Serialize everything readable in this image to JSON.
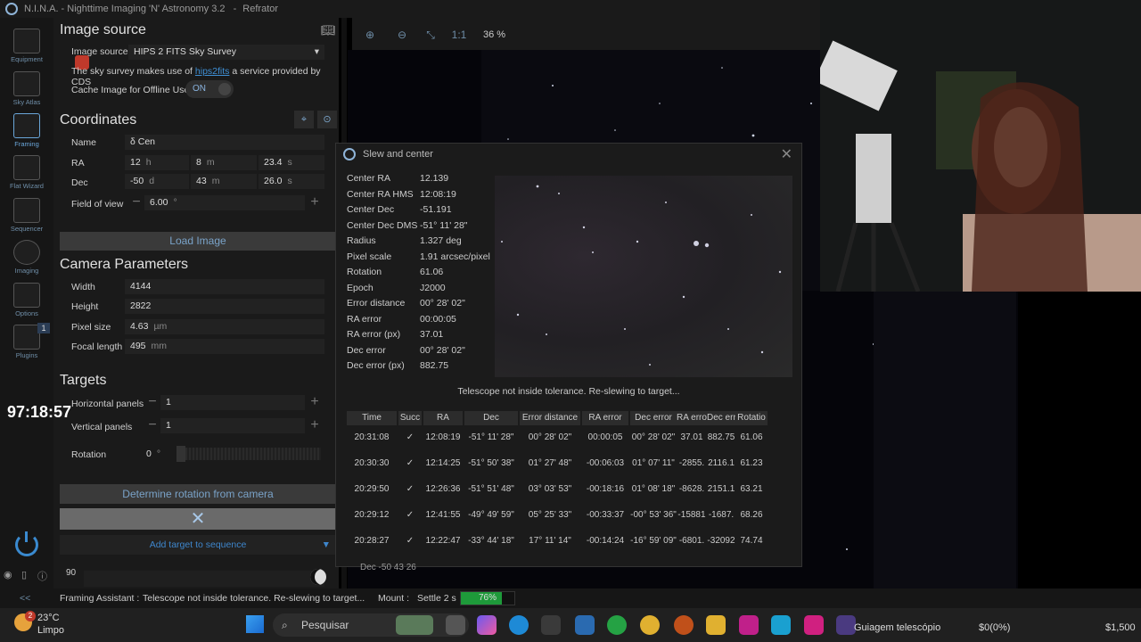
{
  "titlebar": {
    "app": "N.I.N.A. - Nighttime Imaging 'N' Astronomy 3.2",
    "profile": "Refrator"
  },
  "nav": [
    {
      "label": "Equipment"
    },
    {
      "label": "Sky Atlas"
    },
    {
      "label": "Framing"
    },
    {
      "label": "Flat Wizard"
    },
    {
      "label": "Sequencer"
    },
    {
      "label": "Imaging"
    },
    {
      "label": "Options"
    },
    {
      "label": "Plugins"
    }
  ],
  "plugin_badge": "1",
  "image_source": {
    "title": "Image source",
    "label": "Image source",
    "value": "HIPS 2 FITS Sky Survey",
    "note_prefix": "The sky survey makes use of",
    "link": "hips2fits",
    "note_suffix": "a service provided by CDS",
    "cache_label": "Cache Image for Offline Use",
    "cache_state": "ON"
  },
  "coordinates": {
    "title": "Coordinates",
    "name_label": "Name",
    "name": "δ Cen",
    "ra_label": "RA",
    "ra": [
      "12",
      "8",
      "23.4"
    ],
    "ra_units": [
      "h",
      "m",
      "s"
    ],
    "dec_label": "Dec",
    "dec": [
      "-50",
      "43",
      "26.0"
    ],
    "dec_units": [
      "d",
      "m",
      "s"
    ],
    "fov_label": "Field of view",
    "fov": "6.00",
    "fov_unit": "°",
    "load_button": "Load Image"
  },
  "camera": {
    "title": "Camera Parameters",
    "width_label": "Width",
    "width": "4144",
    "height_label": "Height",
    "height": "2822",
    "pixel_label": "Pixel size",
    "pixel": "4.63",
    "pixel_unit": "µm",
    "focal_label": "Focal length",
    "focal": "495",
    "focal_unit": "mm"
  },
  "targets": {
    "title": "Targets",
    "hpanels_label": "Horizontal panels",
    "hpanels": "1",
    "vpanels_label": "Vertical panels",
    "vpanels": "1",
    "rotation_label": "Rotation",
    "rotation": "0",
    "rotation_unit": "°",
    "determine_button": "Determine rotation from camera",
    "add_button": "Add target to sequence",
    "slider_value": "90"
  },
  "timer": "97:18:57",
  "zoom": "36 %",
  "zoom_1to1": "1:1",
  "dialog": {
    "title": "Slew and center",
    "fields": [
      {
        "k": "Center RA",
        "v": "12.139"
      },
      {
        "k": "Center RA HMS",
        "v": "12:08:19"
      },
      {
        "k": "Center Dec",
        "v": "-51.191"
      },
      {
        "k": "Center Dec DMS",
        "v": "-51° 11' 28\""
      },
      {
        "k": "Radius",
        "v": "1.327 deg"
      },
      {
        "k": "Pixel scale",
        "v": "1.91 arcsec/pixel"
      },
      {
        "k": "Rotation",
        "v": "61.06"
      },
      {
        "k": "Epoch",
        "v": "J2000"
      },
      {
        "k": "Error distance",
        "v": "00° 28' 02\""
      },
      {
        "k": "RA error",
        "v": "00:00:05"
      },
      {
        "k": "RA error (px)",
        "v": "37.01"
      },
      {
        "k": "Dec error",
        "v": "00° 28' 02\""
      },
      {
        "k": "Dec error (px)",
        "v": "882.75"
      }
    ],
    "status": "Telescope not inside tolerance. Re-slewing to target...",
    "columns": [
      "Time",
      "Succ",
      "RA",
      "Dec",
      "Error distance",
      "RA error",
      "Dec error",
      "RA erro",
      "Dec err",
      "Rotatio"
    ],
    "rows": [
      [
        "20:31:08",
        "✓",
        "12:08:19",
        "-51° 11' 28\"",
        "00° 28' 02\"",
        "00:00:05",
        "00° 28' 02\"",
        "37.01",
        "882.75",
        "61.06"
      ],
      [
        "20:30:30",
        "✓",
        "12:14:25",
        "-51° 50' 38\"",
        "01° 27' 48\"",
        "-00:06:03",
        "01° 07' 11\"",
        "-2855.",
        "2116.1",
        "61.23"
      ],
      [
        "20:29:50",
        "✓",
        "12:26:36",
        "-51° 51' 48\"",
        "03° 03' 53\"",
        "-00:18:16",
        "01° 08' 18\"",
        "-8628.",
        "2151.1",
        "63.21"
      ],
      [
        "20:29:12",
        "✓",
        "12:41:55",
        "-49° 49' 59\"",
        "05° 25' 33\"",
        "-00:33:37",
        "-00° 53' 36\"",
        "-15881",
        "-1687.",
        "68.26"
      ],
      [
        "20:28:27",
        "✓",
        "12:22:47",
        "-33° 44' 18\"",
        "17° 11' 14\"",
        "-00:14:24",
        "-16° 59' 09\"",
        "-6801.",
        "-32092",
        "74.74"
      ]
    ],
    "behind_text": "Dec -50 43 26"
  },
  "statusbar": {
    "module": "Framing Assistant :",
    "message": "Telescope not inside tolerance. Re-slewing to target...",
    "mount": "Mount :",
    "mount_msg": "Settle 2 s",
    "progress_pct": 76,
    "progress_label": "76%"
  },
  "taskbar": {
    "temp": "23°C",
    "weather": "Limpo",
    "weather_badge": "2",
    "search": "Pesquisar",
    "app_label": "Guiagem telescópio",
    "price1": "$0(0%)",
    "price2": "$1,500"
  }
}
